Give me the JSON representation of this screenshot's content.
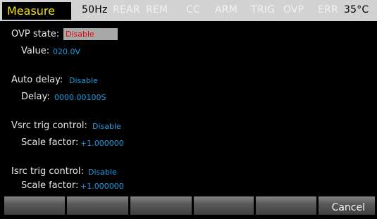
{
  "status": {
    "mode": "Measure",
    "freq": "50Hz",
    "rear": "REAR",
    "rem": "REM",
    "cc": "CC",
    "arm": "ARM",
    "trig": "TRIG",
    "ovp": "OVP",
    "err": "ERR",
    "temp": "35°C"
  },
  "settings": {
    "ovp_state_label": "OVP state:",
    "ovp_state_value": "Disable",
    "ovp_value_label": "Value:",
    "ovp_value": "020.0V",
    "auto_delay_label": "Auto delay:",
    "auto_delay_value": "Disable",
    "delay_label": "Delay:",
    "delay_value": "0000.00100S",
    "vsrc_label": "Vsrc trig control:",
    "vsrc_value": "Disable",
    "vsrc_scale_label": "Scale factor:",
    "vsrc_scale_value": "+1.000000",
    "isrc_label": "Isrc trig control:",
    "isrc_value": "Disable",
    "isrc_scale_label": "Scale factor:",
    "isrc_scale_value": "+1.000000"
  },
  "softkeys": [
    "",
    "",
    "",
    "",
    "",
    "Cancel"
  ]
}
